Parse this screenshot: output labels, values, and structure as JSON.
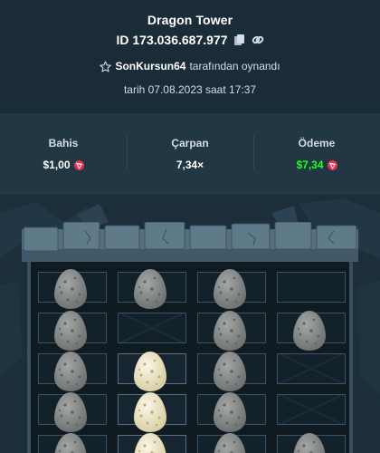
{
  "header": {
    "title": "Dragon Tower",
    "game_id": "ID 173.036.687.977",
    "player": "SonKursun64",
    "played_by_suffix": "tarafından oynandı",
    "date_text": "tarih 07.08.2023 saat 17:37"
  },
  "stats": {
    "bet_label": "Bahis",
    "bet_value": "$1,00",
    "multiplier_label": "Çarpan",
    "multiplier_value": "7,34×",
    "payout_label": "Ödeme",
    "payout_value": "$7,34"
  },
  "colors": {
    "background": "#1a2c38",
    "stats_bg": "#213743",
    "payout_green": "#1fff20",
    "coin_red": "#e2324d",
    "egg_grey": "#8a8d8b",
    "egg_gold": "#f3ecd2"
  },
  "board": {
    "columns": 4,
    "visible_rows": [
      [
        "egg",
        "egg",
        "egg",
        "empty"
      ],
      [
        "egg",
        "empty",
        "egg",
        "egg"
      ],
      [
        "egg",
        "picked",
        "egg",
        "empty"
      ],
      [
        "egg",
        "picked",
        "egg",
        "empty"
      ],
      [
        "egg",
        "picked",
        "egg",
        "egg"
      ]
    ]
  },
  "icons": {
    "copy": "copy-icon",
    "link": "link-icon",
    "star": "star-icon",
    "currency": "tron-coin-icon"
  }
}
